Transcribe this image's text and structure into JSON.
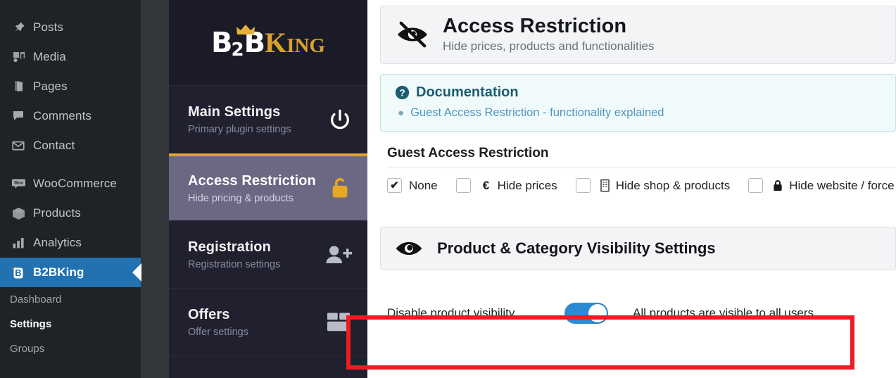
{
  "wp_sidebar": {
    "items": [
      {
        "label": "Posts",
        "icon": "pin-icon",
        "active": false
      },
      {
        "label": "Media",
        "icon": "media-icon",
        "active": false
      },
      {
        "label": "Pages",
        "icon": "pages-icon",
        "active": false
      },
      {
        "label": "Comments",
        "icon": "comment-icon",
        "active": false
      },
      {
        "label": "Contact",
        "icon": "envelope-icon",
        "active": false
      },
      {
        "label": "WooCommerce",
        "icon": "woocommerce-icon",
        "active": false
      },
      {
        "label": "Products",
        "icon": "box-icon",
        "active": false
      },
      {
        "label": "Analytics",
        "icon": "bar-chart-icon",
        "active": false
      },
      {
        "label": "B2BKing",
        "icon": "b2bking-icon",
        "active": true
      }
    ],
    "submenu": [
      {
        "label": "Dashboard",
        "current": false
      },
      {
        "label": "Settings",
        "current": true
      },
      {
        "label": "Groups",
        "current": false
      }
    ],
    "accent_color": "#2271b1",
    "background_color": "#1d2327"
  },
  "plugin_nav": {
    "brand": {
      "text_primary": "B",
      "text_sub": "2",
      "text_primary_2": "B",
      "text_king_big": "K",
      "text_king_small": "ING",
      "crown_icon": "crown-icon",
      "gold_color": "#d9a22e"
    },
    "items": [
      {
        "title": "Main Settings",
        "subtitle": "Primary plugin settings",
        "icon": "power-icon",
        "active": false
      },
      {
        "title": "Access Restriction",
        "subtitle": "Hide pricing & products",
        "icon": "lock-open-icon",
        "active": true
      },
      {
        "title": "Registration",
        "subtitle": "Registration settings",
        "icon": "user-plus-icon",
        "active": false
      },
      {
        "title": "Offers",
        "subtitle": "Offer settings",
        "icon": "package-icon",
        "active": false
      }
    ],
    "active_highlight_color": "#e0a526"
  },
  "page": {
    "title": "Access Restriction",
    "subtitle": "Hide prices, products and functionalities",
    "icon": "eye-slash-icon"
  },
  "documentation": {
    "heading": "Documentation",
    "icon": "question-circle-icon",
    "links": [
      "Guest Access Restriction - functionality explained"
    ],
    "link_color": "#4f96bf"
  },
  "guest_access": {
    "section_title": "Guest Access Restriction",
    "options": [
      {
        "label": "None",
        "icon": null,
        "checked": true
      },
      {
        "label": "Hide prices",
        "icon": "euro-icon",
        "checked": false
      },
      {
        "label": "Hide shop & products",
        "icon": "shop-building-icon",
        "checked": false
      },
      {
        "label": "Hide website / force lo",
        "icon": "lock-icon",
        "checked": false
      }
    ]
  },
  "visibility_section": {
    "title": "Product & Category Visibility Settings",
    "icon": "eye-icon"
  },
  "product_visibility": {
    "label": "Disable product visibility",
    "toggle_on": true,
    "toggle_color": "#2b8ad4",
    "description": "All products are visible to all users"
  },
  "annotation": {
    "type": "highlight-rectangle",
    "color": "#ed1c24"
  }
}
